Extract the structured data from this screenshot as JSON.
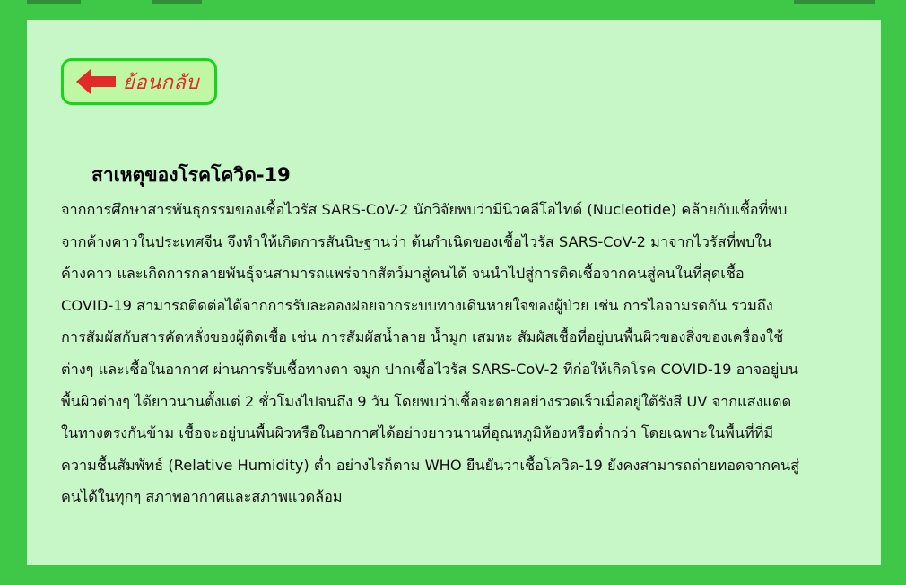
{
  "back_button": {
    "label": "ย้อนกลับ",
    "icon": "red-left-arrow"
  },
  "article": {
    "title": "สาเหตุของโรคโควิด-19",
    "lines": [
      "จากการศึกษาสารพันธุกรรมของเชื้อไวรัส SARS-CoV-2 นักวิจัยพบว่ามีนิวคลีโอไทด์ (Nucleotide) คล้ายกับเชื้อที่พบ",
      "จากค้างคาวในประเทศจีน จึงทำให้เกิดการสันนิษฐานว่า ต้นกำเนิดของเชื้อไวรัส SARS-CoV-2 มาจากไวรัสที่พบใน",
      "ค้างคาว และเกิดการกลายพันธุ์จนสามารถแพร่จากสัตว์มาสู่คนได้ จนนำไปสู่การติดเชื้อจากคนสู่คนในที่สุดเชื้อ",
      "COVID-19 สามารถติดต่อได้จากการรับละอองฝอยจากระบบทางเดินหายใจของผู้ป่วย เช่น การไอจามรดกัน รวมถึง",
      "การสัมผัสกับสารคัดหลั่งของผู้ติดเชื้อ เช่น การสัมผัสน้ำลาย น้ำมูก เสมหะ สัมผัสเชื้อที่อยู่บนพื้นผิวของสิ่งของเครื่องใช้",
      "ต่างๆ และเชื้อในอากาศ ผ่านการรับเชื้อทางตา จมูก ปากเชื้อไวรัส SARS-CoV-2 ที่ก่อให้เกิดโรค COVID-19 อาจอยู่บน",
      "พื้นผิวต่างๆ ได้ยาวนานตั้งแต่ 2 ชั่วโมงไปจนถึง 9 วัน โดยพบว่าเชื้อจะตายอย่างรวดเร็วเมื่ออยู่ใต้รังสี UV จากแสงแดด",
      "ในทางตรงกันข้าม เชื้อจะอยู่บนพื้นผิวหรือในอากาศได้อย่างยาวนานที่อุณหภูมิห้องหรือต่ำกว่า โดยเฉพาะในพื้นที่ที่มี",
      "ความชื้นสัมพัทธ์ (Relative Humidity) ต่ำ อย่างไรก็ตาม WHO ยืนยันว่าเชื้อโควิด-19 ยังคงสามารถถ่ายทอดจากคนสู่",
      "คนได้ในทุกๆ สภาพอากาศและสภาพแวดล้อม"
    ]
  },
  "colors": {
    "page_background": "#3fc847",
    "panel_background": "#c8f7c7",
    "button_background": "#bff7a3",
    "button_border": "#19d519",
    "button_text": "#e12a2a",
    "arrow": "#e12a2a"
  }
}
